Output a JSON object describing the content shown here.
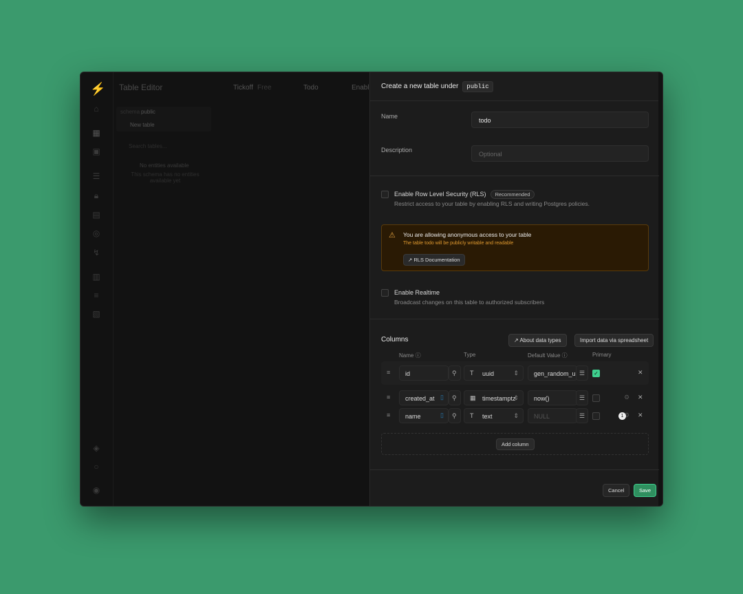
{
  "background": {
    "title": "Table Editor",
    "project": "Tickoff",
    "plan": "Free",
    "branch": "Todo",
    "enable": "Enable b",
    "schema_label": "schema",
    "schema": "public",
    "new_table": "New table",
    "search": "Search tables...",
    "empty_title": "No entities available",
    "empty_desc": "This schema has no entities available yet"
  },
  "panel": {
    "title": "Create a new table under",
    "schema": "public",
    "name_label": "Name",
    "name_value": "todo",
    "description_label": "Description",
    "description_placeholder": "Optional",
    "rls": {
      "label": "Enable Row Level Security (RLS)",
      "badge": "Recommended",
      "desc": "Restrict access to your table by enabling RLS and writing Postgres policies.",
      "checked": false
    },
    "warning": {
      "title": "You are allowing anonymous access to your table",
      "desc": "The table todo will be publicly writable and readable",
      "button": "RLS Documentation",
      "color": "#f0a030"
    },
    "realtime": {
      "label": "Enable Realtime",
      "desc": "Broadcast changes on this table to authorized subscribers",
      "checked": false
    },
    "columns": {
      "title": "Columns",
      "about": "About data types",
      "import": "Import data via spreadsheet",
      "headers": {
        "name": "Name",
        "type": "Type",
        "default": "Default Value",
        "primary": "Primary"
      },
      "rows": [
        {
          "name": "id",
          "type": "uuid",
          "type_icon": "text-type-icon",
          "default": "gen_random_uuid()",
          "default_placeholder": "",
          "primary": true
        },
        {
          "name": "created_at",
          "type": "timestamptz",
          "type_icon": "calendar-icon",
          "default": "now()",
          "default_placeholder": "",
          "primary": false
        },
        {
          "name": "name",
          "type": "text",
          "type_icon": "text-type-icon",
          "default": "",
          "default_placeholder": "NULL",
          "primary": false,
          "badge": "1"
        }
      ],
      "add": "Add column"
    },
    "cancel": "Cancel",
    "save": "Save",
    "accent": "#3ecf8e"
  }
}
